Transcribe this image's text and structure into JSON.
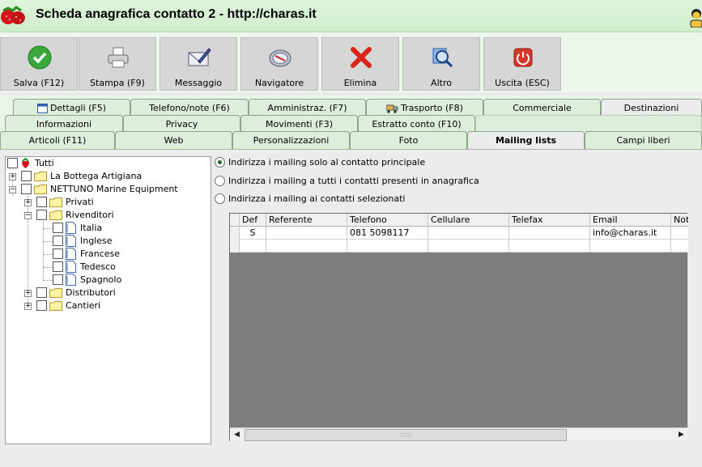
{
  "window": {
    "title": "Scheda anagrafica contatto 2 - http://charas.it"
  },
  "toolbar": {
    "buttons": [
      {
        "label": "Salva (F12)",
        "icon": "check-icon"
      },
      {
        "label": "Stampa (F9)",
        "icon": "printer-icon"
      },
      {
        "label": "Messaggio",
        "icon": "envelope-pen-icon"
      },
      {
        "label": "Navigatore",
        "icon": "compass-icon"
      },
      {
        "label": "Elimina",
        "icon": "red-x-icon"
      },
      {
        "label": "Altro",
        "icon": "magnifier-icon"
      },
      {
        "label": "Uscita (ESC)",
        "icon": "power-icon"
      }
    ]
  },
  "tabs": {
    "row1": [
      "Dettagli (F5)",
      "Telefono/note (F6)",
      "Amministraz. (F7)",
      "Trasporto (F8)",
      "Commerciale",
      "Destinazioni"
    ],
    "row2": [
      "Informazioni",
      "Privacy",
      "Movimenti (F3)",
      "Estratto conto (F10)"
    ],
    "row3": [
      "Articoli (F11)",
      "Web",
      "Personalizzazioni",
      "Foto",
      "Mailing lists",
      "Campi liberi"
    ],
    "active": "Mailing lists"
  },
  "tree": {
    "root": "Tutti",
    "items": [
      "La Bottega Artigiana",
      "NETTUNO Marine Equipment",
      "Privati",
      "Rivenditori",
      "Italia",
      "Inglese",
      "Francese",
      "Tedesco",
      "Spagnolo",
      "Distributori",
      "Cantieri"
    ]
  },
  "options": {
    "items": [
      "Indirizza i mailing solo al contatto principale",
      "Indirizza i mailing a tutti i contatti presenti in anagrafica",
      "Indirizza i mailing ai contatti selezionati"
    ],
    "selected_index": 0
  },
  "grid": {
    "columns": [
      "Def",
      "Referente",
      "Telefono",
      "Cellulare",
      "Telefax",
      "Email",
      "Not"
    ],
    "rows": [
      [
        "S",
        "",
        "081 5098117",
        "",
        "",
        "info@charas.it",
        ""
      ],
      [
        "",
        "",
        "",
        "",
        "",
        "",
        ""
      ]
    ],
    "scroll_grip": "::::::"
  },
  "colors": {
    "titlebar": "#d6f2d2",
    "accent": "#1b6f1b",
    "grid_bg": "#7e7e7e"
  }
}
